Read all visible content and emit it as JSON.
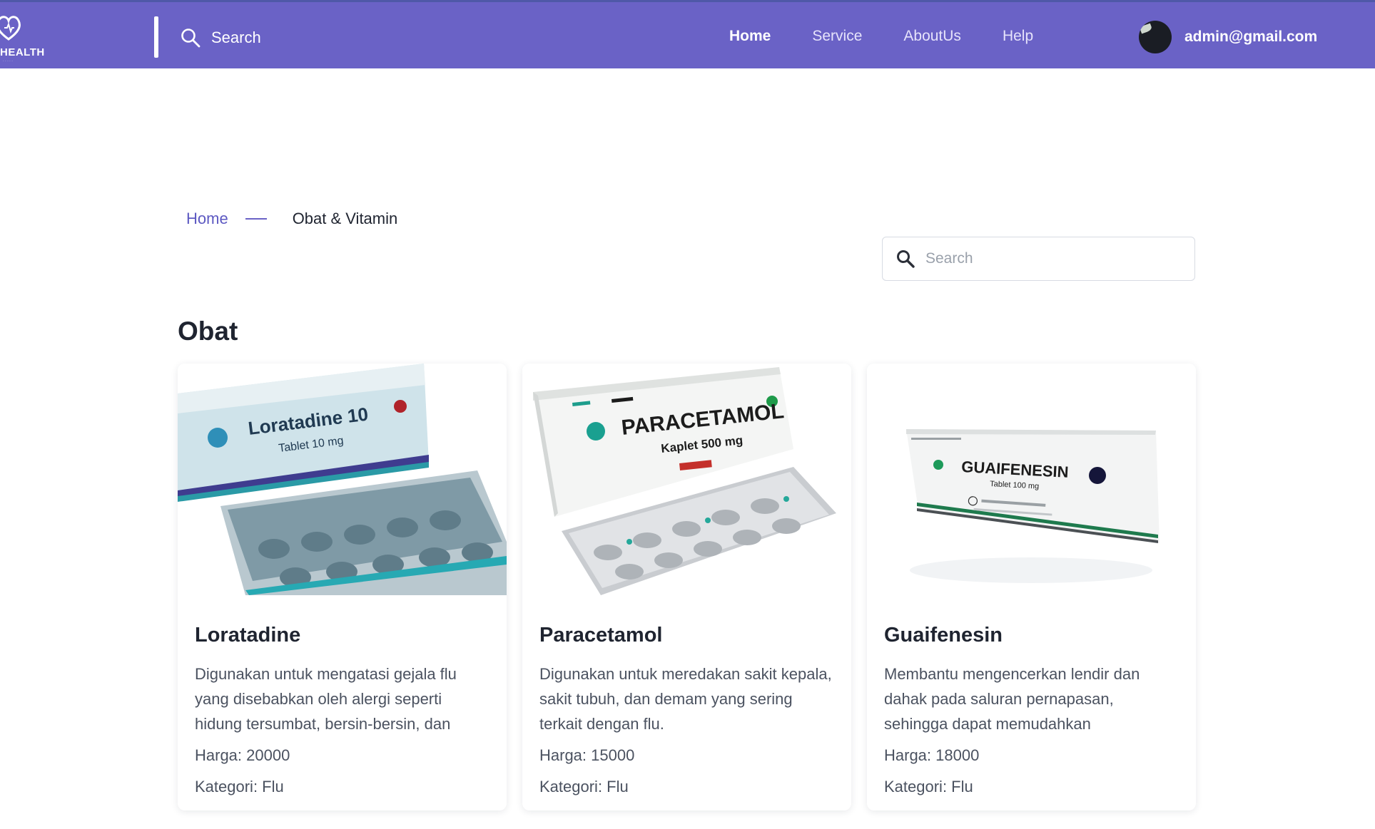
{
  "brand": {
    "name": "HEALTH"
  },
  "nav": {
    "search_label": "Search",
    "links": [
      "Home",
      "Service",
      "AboutUs",
      "Help"
    ],
    "user_email": "admin@gmail.com"
  },
  "breadcrumb": {
    "home": "Home",
    "current": "Obat & Vitamin"
  },
  "search": {
    "placeholder": "Search"
  },
  "section": {
    "title": "Obat"
  },
  "products": [
    {
      "name": "Loratadine",
      "box_title": "Loratadine 10",
      "box_subtitle": "Tablet 10 mg",
      "description": "Digunakan untuk mengatasi gejala flu yang disebabkan oleh alergi seperti hidung tersumbat, bersin-bersin, dan",
      "price": "Harga: 20000",
      "category": "Kategori: Flu"
    },
    {
      "name": "Paracetamol",
      "box_title": "PARACETAMOL",
      "box_subtitle": "Kaplet 500 mg",
      "description": "Digunakan untuk meredakan sakit kepala, sakit tubuh, dan demam yang sering terkait dengan flu.",
      "price": "Harga: 15000",
      "category": "Kategori: Flu"
    },
    {
      "name": "Guaifenesin",
      "box_title": "GUAIFENESIN",
      "box_subtitle": "Tablet 100 mg",
      "description": "Membantu mengencerkan lendir dan dahak pada saluran pernapasan, sehingga dapat memudahkan",
      "price": "Harga: 18000",
      "category": "Kategori: Flu"
    }
  ],
  "colors": {
    "navbar": "#6a62c6",
    "accent": "#5d59c2"
  }
}
